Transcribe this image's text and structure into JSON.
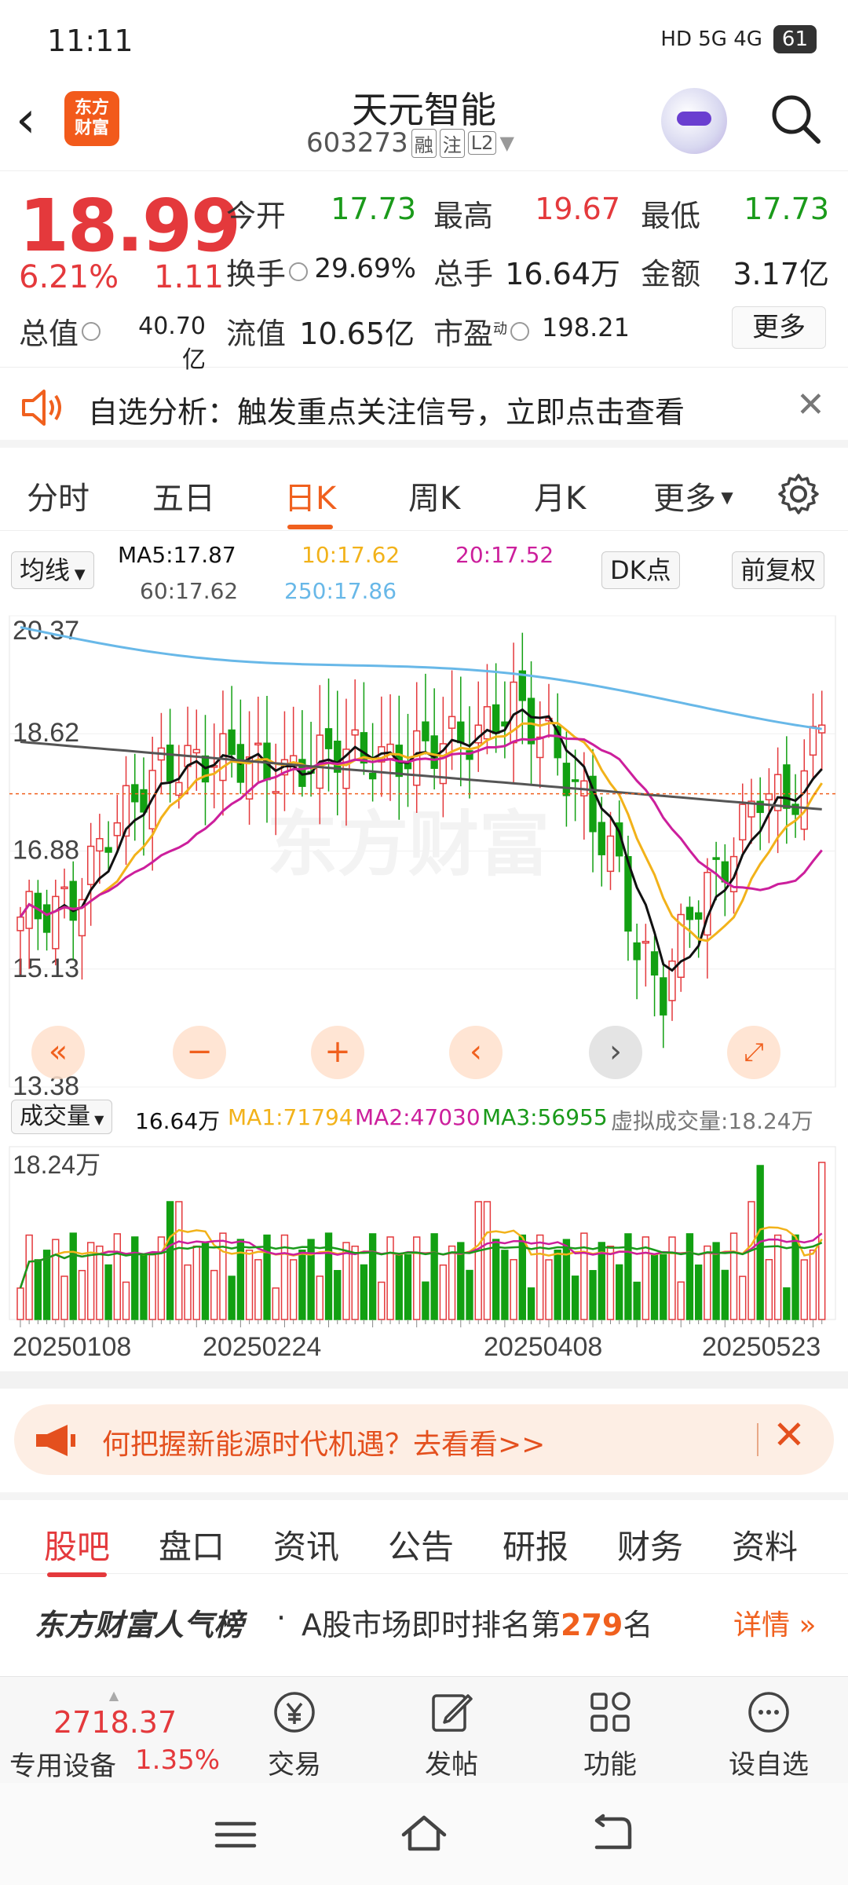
{
  "status": {
    "time": "11:11",
    "signals": "HD 5G 4G",
    "battery": "61"
  },
  "header": {
    "name": "天元智能",
    "code": "603273",
    "tags": [
      "融",
      "注",
      "L2"
    ],
    "logo": "东方\n财富"
  },
  "quote": {
    "price": "18.99",
    "pct": "6.21%",
    "chg": "1.11",
    "rows": [
      [
        {
          "label": "今开",
          "value": "17.73",
          "color": "green"
        },
        {
          "label": "最高",
          "value": "19.67",
          "color": "red"
        },
        {
          "label": "最低",
          "value": "17.73",
          "color": "green"
        }
      ],
      [
        {
          "label": "换手",
          "value": "29.69%"
        },
        {
          "label": "总手",
          "value": "16.64万"
        },
        {
          "label": "金额",
          "value": "3.17亿"
        }
      ],
      [
        {
          "label": "流值",
          "value": "10.65亿"
        },
        {
          "label": "市盈",
          "value": "198.21"
        }
      ]
    ],
    "total_value_label": "总值",
    "total_value": "40.70亿",
    "pe_sup": "动",
    "more": "更多"
  },
  "notice": {
    "text": "自选分析：触发重点关注信号，立即点击查看"
  },
  "period_tabs": [
    "分时",
    "五日",
    "日K",
    "周K",
    "月K",
    "更多"
  ],
  "active_period": "日K",
  "chart": {
    "ma_selector": "均线",
    "ma5": "MA5:17.87",
    "ma10": "10:17.62",
    "ma20": "20:17.52",
    "ma60": "60:17.62",
    "ma250": "250:17.86",
    "dk": "DK点",
    "fq": "前复权",
    "price_labels": [
      "20.37",
      "18.62",
      "16.88",
      "15.13",
      "13.38"
    ],
    "vol_selector": "成交量",
    "vol_val": "16.64万",
    "vma1": "MA1:71794",
    "vma2": "MA2:47030",
    "vma3": "MA3:56955",
    "virtual": "虚拟成交量:18.24万",
    "vol_max": "18.24万",
    "dates": [
      "20250108",
      "20250224",
      "20250408",
      "20250523"
    ],
    "watermark": "东方财富",
    "colors": {
      "up": "#e4393c",
      "down": "#12a012",
      "ma5": "#111111",
      "ma10": "#f2b21a",
      "ma20": "#cc1f9c",
      "ma60": "#555555",
      "ma250": "#68b8e8"
    }
  },
  "chart_data": {
    "type": "candlestick",
    "ylim": [
      13.38,
      20.37
    ],
    "ma": {
      "MA5": 17.87,
      "MA10": 17.62,
      "MA20": 17.52,
      "MA60": 17.62,
      "MA250": 17.86
    },
    "volume": {
      "latest": "16.64万",
      "MA1": 71794,
      "MA2": 47030,
      "MA3": 56955,
      "max": "18.24万"
    },
    "x_ticks": [
      "20250108",
      "20250224",
      "20250408",
      "20250523"
    ]
  },
  "promo": {
    "text": "何把握新能源时代机遇？去看看>>"
  },
  "bottom_tabs": [
    "股吧",
    "盘口",
    "资讯",
    "公告",
    "研报",
    "财务",
    "资料"
  ],
  "rank": {
    "brand": "东方财富人气榜",
    "sep": "·",
    "desc_prefix": "A股市场即时排名第",
    "num": "279",
    "desc_suffix": "名",
    "detail": "详情"
  },
  "toolbar": {
    "index_value": "2718.37",
    "index_name": "专用设备",
    "index_pct": "1.35%",
    "items": [
      "交易",
      "发帖",
      "功能",
      "设自选"
    ]
  }
}
